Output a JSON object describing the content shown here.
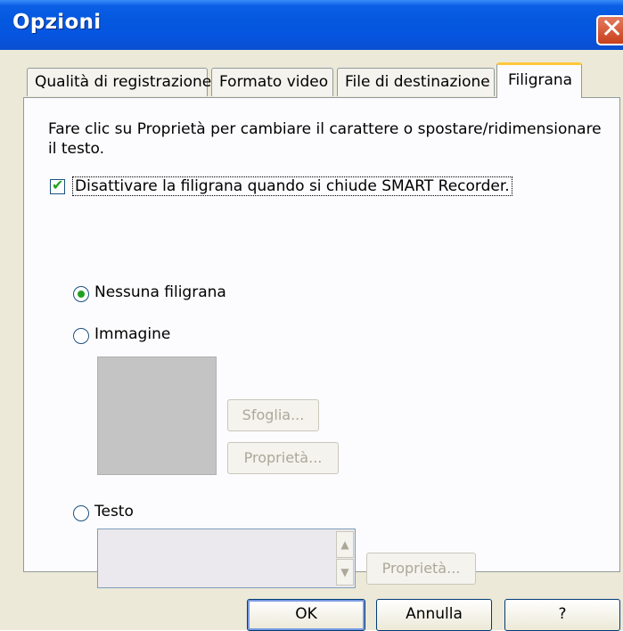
{
  "window": {
    "title": "Opzioni",
    "close_label": "✕"
  },
  "tabs": [
    {
      "label": "Qualità di registrazione"
    },
    {
      "label": "Formato video"
    },
    {
      "label": "File di destinazione"
    },
    {
      "label": "Filigrana"
    }
  ],
  "panel": {
    "description": "Fare clic su Proprietà per cambiare il carattere o spostare/ridimensionare il testo.",
    "disable_checkbox": {
      "label": "Disattivare la filigrana quando si chiude SMART Recorder.",
      "checked": true
    },
    "options": [
      {
        "label": "Nessuna filigrana",
        "selected": true
      },
      {
        "label": "Immagine",
        "selected": false
      },
      {
        "label": "Testo",
        "selected": false
      }
    ],
    "image": {
      "browse_label": "Sfoglia...",
      "properties_label": "Proprietà..."
    },
    "text": {
      "properties_label": "Proprietà..."
    }
  },
  "buttons": {
    "ok": "OK",
    "cancel": "Annulla",
    "help": "?"
  },
  "icons": {
    "scroll_up": "scroll-up-icon",
    "scroll_down": "scroll-down-icon",
    "check": "checkmark-icon",
    "close": "close-icon"
  },
  "colors": {
    "titlebar": "#0458de",
    "dialog_bg": "#ece9d8",
    "panel_bg": "#fcfcfe",
    "active_tab_accent": "#ffc83c",
    "check_green": "#21a121"
  }
}
